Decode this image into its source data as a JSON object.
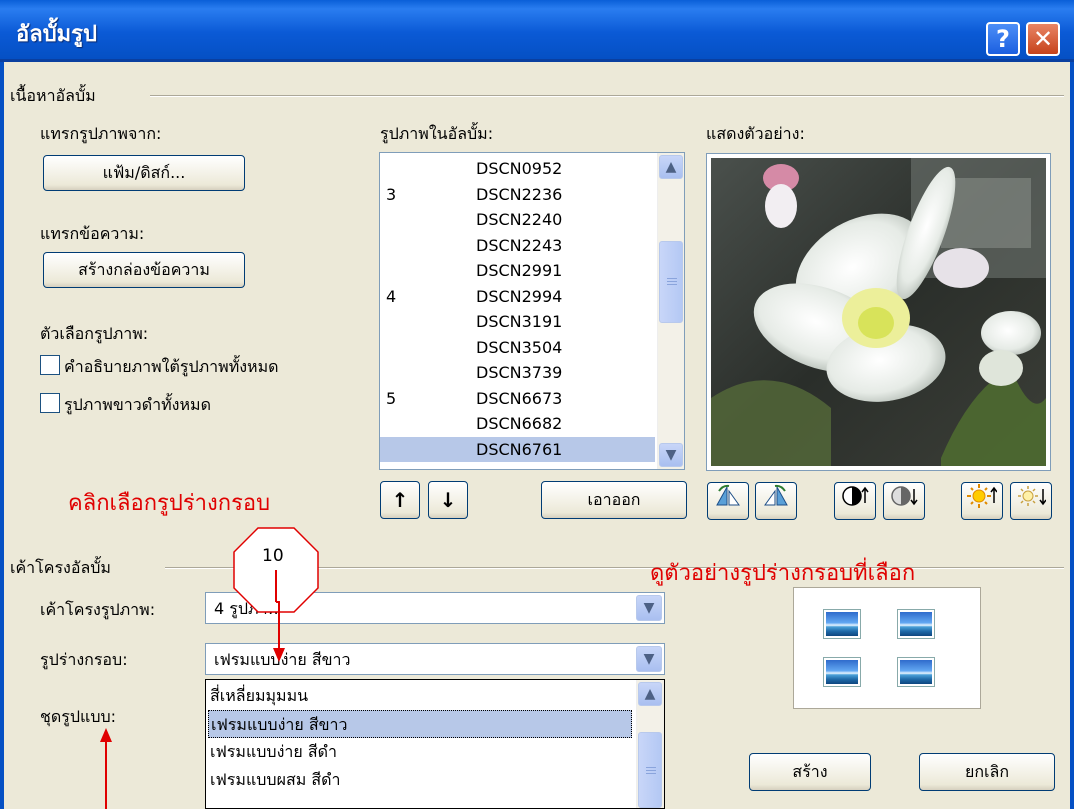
{
  "window": {
    "title": "อัลบั้มรูป",
    "help_glyph": "?",
    "close_glyph": "✕"
  },
  "album_content": {
    "section_title": "เนื้อหาอัลบั้ม",
    "insert_picture_label": "แทรกรูปภาพจาก:",
    "file_disk_button": "แฟ้ม/ดิสก์...",
    "insert_text_label": "แทรกข้อความ:",
    "new_textbox_button": "สร้างกล่องข้อความ",
    "picture_options_label": "ตัวเลือกรูปภาพ:",
    "caption_checkbox": "คำอธิบายภาพใต้รูปภาพทั้งหมด",
    "caption_checked": false,
    "bw_checkbox": "รูปภาพขาวดำทั้งหมด",
    "bw_checked": false
  },
  "pictures_list": {
    "label": "รูปภาพในอัลบั้ม:",
    "items": [
      {
        "num": "",
        "name": "DSCN0952"
      },
      {
        "num": "3",
        "name": "DSCN2236"
      },
      {
        "num": "",
        "name": "DSCN2240"
      },
      {
        "num": "",
        "name": "DSCN2243"
      },
      {
        "num": "",
        "name": "DSCN2991"
      },
      {
        "num": "4",
        "name": "DSCN2994"
      },
      {
        "num": "",
        "name": "DSCN3191"
      },
      {
        "num": "",
        "name": "DSCN3504"
      },
      {
        "num": "",
        "name": "DSCN3739"
      },
      {
        "num": "5",
        "name": "DSCN6673"
      },
      {
        "num": "",
        "name": "DSCN6682"
      },
      {
        "num": "",
        "name": "DSCN6761"
      }
    ],
    "selected_index": 11,
    "move_up_glyph": "↑",
    "move_down_glyph": "↓",
    "remove_button": "เอาออก"
  },
  "preview": {
    "label": "แสดงตัวอย่าง:"
  },
  "album_layout": {
    "section_title": "เค้าโครงอัลบั้ม",
    "picture_layout_label": "เค้าโครงรูปภาพ:",
    "picture_layout_value": "4 รูปภาพ",
    "frame_shape_label": "รูปร่างกรอบ:",
    "frame_shape_value": "เฟรมแบบง่าย สีขาว",
    "design_theme_label": "ชุดรูปแบบ:",
    "frame_options": [
      "สี่เหลี่ยมมุมมน",
      "เฟรมแบบง่าย สีขาว",
      "เฟรมแบบง่าย สีดำ",
      "เฟรมแบบผสม สีดำ"
    ],
    "selected_frame_index": 1
  },
  "footer": {
    "create_button": "สร้าง",
    "cancel_button": "ยกเลิก"
  },
  "annotations": {
    "click_frame_shape": "คลิกเลือกรูปร่างกรอบ",
    "preview_frame_shape": "ดูตัวอย่างรูปร่างกรอบที่เลือก",
    "step_number": "10",
    "color": "#e00000"
  }
}
